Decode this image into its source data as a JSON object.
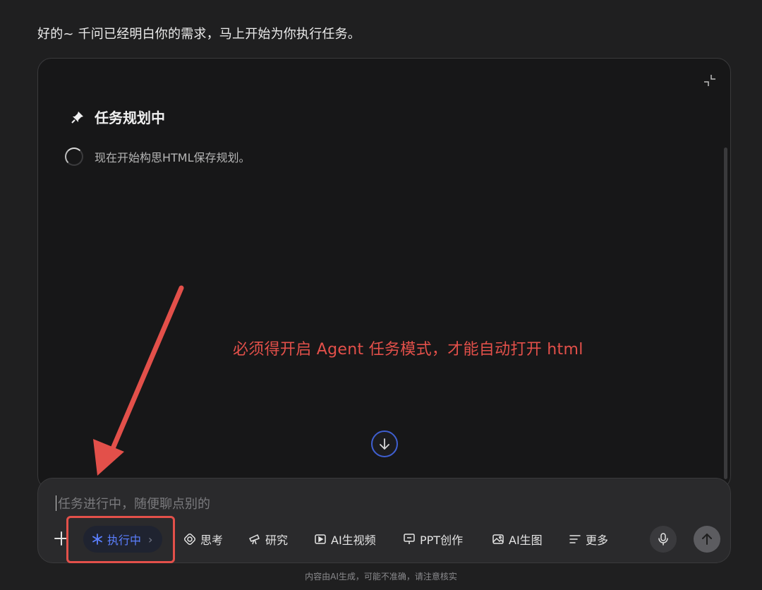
{
  "chat": {
    "intro": "好的~ 千问已经明白你的需求，马上开始为你执行任务。"
  },
  "task_panel": {
    "title": "任务规划中",
    "step_text": "现在开始构思HTML保存规划。",
    "collapse_icon": "collapse-icon",
    "scroll_down_icon": "arrow-down-icon"
  },
  "annotation": {
    "text": "必须得开启 Agent 任务模式，才能自动打开 html",
    "color": "#e3504a"
  },
  "composer": {
    "placeholder": "任务进行中，随便聊点别的",
    "value": "",
    "tools": [
      {
        "label": "执行中",
        "icon": "asterisk-icon",
        "active": true
      },
      {
        "label": "思考",
        "icon": "brain-icon"
      },
      {
        "label": "研究",
        "icon": "telescope-icon"
      },
      {
        "label": "AI生视频",
        "icon": "video-icon"
      },
      {
        "label": "PPT创作",
        "icon": "presentation-icon"
      },
      {
        "label": "AI生图",
        "icon": "image-icon"
      },
      {
        "label": "更多",
        "icon": "menu-icon"
      }
    ],
    "accent_color": "#5b7fff"
  },
  "footer": {
    "disclaimer": "内容由AI生成，可能不准确，请注意核实"
  }
}
